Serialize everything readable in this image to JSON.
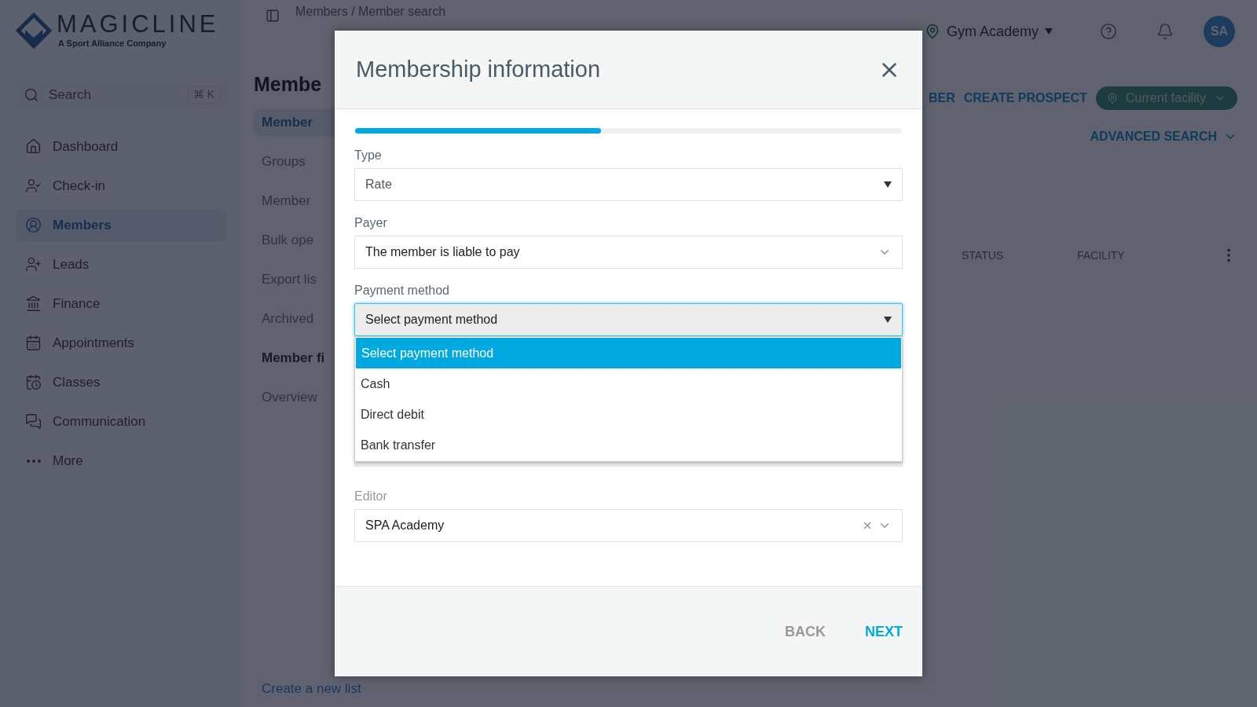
{
  "brand": {
    "name": "MAGICLINE",
    "tagline": "A Sport Alliance Company"
  },
  "search": {
    "placeholder": "Search",
    "shortcut": "⌘ K"
  },
  "sidebar": {
    "items": [
      {
        "label": "Dashboard",
        "selected": false
      },
      {
        "label": "Check-in",
        "selected": false
      },
      {
        "label": "Members",
        "selected": true
      },
      {
        "label": "Leads",
        "selected": false
      },
      {
        "label": "Finance",
        "selected": false
      },
      {
        "label": "Appointments",
        "selected": false
      },
      {
        "label": "Classes",
        "selected": false
      },
      {
        "label": "Communication",
        "selected": false
      },
      {
        "label": "More",
        "selected": false
      }
    ]
  },
  "breadcrumb": "Members / Member search",
  "page_title": "Membe",
  "subnav": {
    "items": [
      {
        "label": "Member",
        "kind": "link",
        "selected": true
      },
      {
        "label": "Groups",
        "kind": "link",
        "selected": false
      },
      {
        "label": "Member",
        "kind": "link",
        "selected": false
      },
      {
        "label": "Bulk ope",
        "kind": "link",
        "selected": false
      },
      {
        "label": "Export lis",
        "kind": "link",
        "selected": false
      },
      {
        "label": "Archived",
        "kind": "link",
        "selected": false
      },
      {
        "label": "Member fi",
        "kind": "heading",
        "selected": false
      },
      {
        "label": "Overview",
        "kind": "link",
        "selected": false
      }
    ],
    "create_link": "Create a new list"
  },
  "topbar": {
    "facility": "Gym Academy",
    "avatar": "SA"
  },
  "actions": [
    "BER",
    "CREATE PROSPECT"
  ],
  "facility_filter": "Current facility",
  "advanced_search": "ADVANCED SEARCH",
  "table": {
    "columns": [
      "STATUS",
      "FACILITY"
    ]
  },
  "modal": {
    "title": "Membership information",
    "progress": {
      "level": 0.45
    },
    "fields": [
      {
        "label": "Type",
        "value": "Rate",
        "kind": "native"
      },
      {
        "label": "Payer",
        "value": "The member is liable to pay",
        "kind": "select"
      },
      {
        "label": "Payment method",
        "value": "Select payment method",
        "kind": "native",
        "open": true,
        "options": [
          {
            "label": "Select payment method",
            "selected": true
          },
          {
            "label": "Cash",
            "selected": false
          },
          {
            "label": "Direct debit",
            "selected": false
          },
          {
            "label": "Bank transfer",
            "selected": false
          }
        ]
      },
      {
        "kind": "hidden"
      },
      {
        "label": "Editor",
        "value": "SPA Academy",
        "kind": "clearable",
        "disabled_label": true
      }
    ],
    "buttons": [
      {
        "label": "BACK",
        "primary": false
      },
      {
        "label": "NEXT",
        "primary": true
      }
    ]
  }
}
